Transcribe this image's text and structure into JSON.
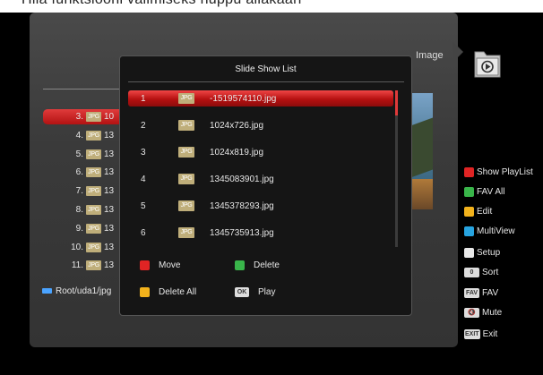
{
  "top_caption": "Hiia funktsiooni valimiseks nuppu allakaari",
  "browser": {
    "mode_label": "Image",
    "path": "Root/uda1/jpg",
    "items": [
      {
        "num": "3.",
        "name": "10",
        "selected": true
      },
      {
        "num": "4.",
        "name": "13"
      },
      {
        "num": "5.",
        "name": "13"
      },
      {
        "num": "6.",
        "name": "13"
      },
      {
        "num": "7.",
        "name": "13"
      },
      {
        "num": "8.",
        "name": "13"
      },
      {
        "num": "9.",
        "name": "13"
      },
      {
        "num": "10.",
        "name": "13"
      },
      {
        "num": "11.",
        "name": "13"
      }
    ]
  },
  "jpg_tag": "JPG",
  "sidebar": {
    "items": [
      {
        "type": "color",
        "color": "#e02424",
        "label": "Show PlayList"
      },
      {
        "type": "color",
        "color": "#39b54a",
        "label": "FAV All"
      },
      {
        "type": "color",
        "color": "#f2b21c",
        "label": "Edit"
      },
      {
        "type": "color",
        "color": "#27a4e0",
        "label": "MultiView"
      },
      {
        "type": "color",
        "color": "#e8e8e8",
        "label": "Setup"
      },
      {
        "type": "key",
        "key": "0",
        "label": "Sort"
      },
      {
        "type": "key",
        "key": "FAV",
        "label": "FAV"
      },
      {
        "type": "key",
        "key": "🔇",
        "label": "Mute"
      },
      {
        "type": "key",
        "key": "EXIT",
        "label": "Exit"
      }
    ]
  },
  "dialog": {
    "title": "Slide Show List",
    "rows": [
      {
        "num": "1",
        "name": "-1519574110.jpg",
        "selected": true
      },
      {
        "num": "2",
        "name": "1024x726.jpg"
      },
      {
        "num": "3",
        "name": "1024x819.jpg"
      },
      {
        "num": "4",
        "name": "1345083901.jpg"
      },
      {
        "num": "5",
        "name": "1345378293.jpg"
      },
      {
        "num": "6",
        "name": "1345735913.jpg"
      }
    ],
    "buttons": {
      "move": {
        "label": "Move",
        "color": "#e02424"
      },
      "delete": {
        "label": "Delete",
        "color": "#39b54a"
      },
      "delete_all": {
        "label": "Delete All",
        "color": "#f2b21c"
      },
      "play": {
        "label": "Play",
        "key": "OK"
      }
    }
  }
}
